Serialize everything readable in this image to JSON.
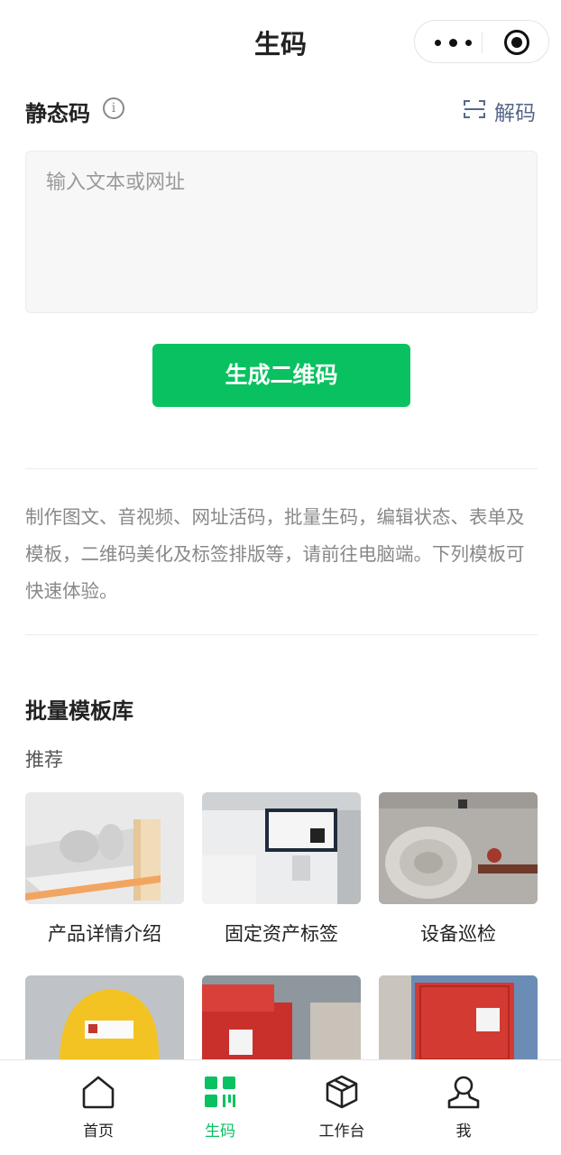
{
  "header": {
    "title": "生码"
  },
  "static_code": {
    "label": "静态码",
    "decode_label": "解码"
  },
  "input": {
    "placeholder": "输入文本或网址",
    "value": ""
  },
  "generate_button": "生成二维码",
  "description": "制作图文、音视频、网址活码，批量生码，编辑状态、表单及模板，二维码美化及标签排版等，请前往电脑端。下列模板可快速体验。",
  "template_library": {
    "title": "批量模板库",
    "subtitle": "推荐",
    "items": [
      {
        "label": "产品详情介绍"
      },
      {
        "label": "固定资产标签"
      },
      {
        "label": "设备巡检"
      }
    ]
  },
  "tabbar": {
    "items": [
      {
        "label": "首页",
        "icon": "home-icon",
        "active": false
      },
      {
        "label": "生码",
        "icon": "qrcode-icon",
        "active": true
      },
      {
        "label": "工作台",
        "icon": "box-icon",
        "active": false
      },
      {
        "label": "我",
        "icon": "user-icon",
        "active": false
      }
    ]
  },
  "colors": {
    "primary": "#09c160",
    "link": "#57688a",
    "muted": "#888888"
  }
}
